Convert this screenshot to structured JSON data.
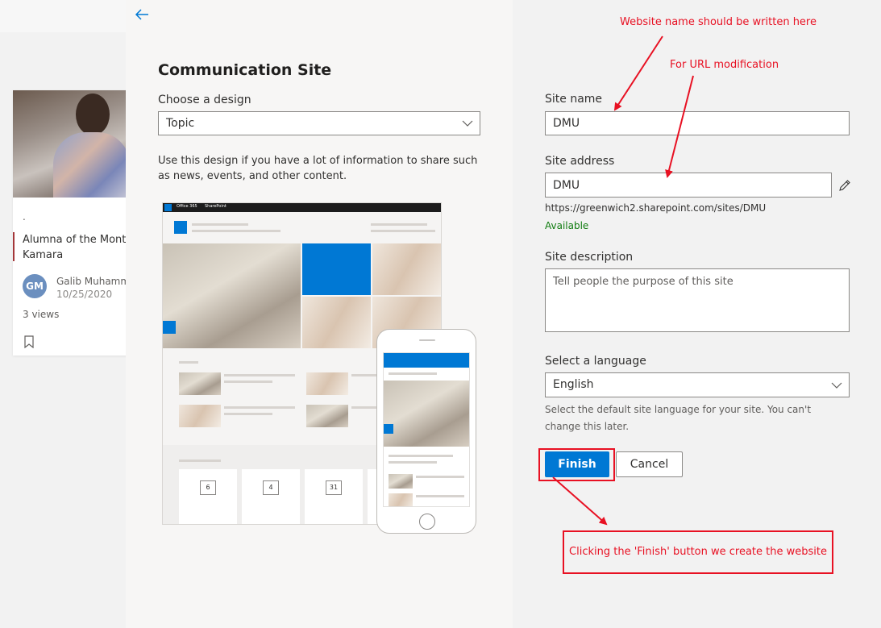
{
  "background": {
    "news_card": {
      "dot": ".",
      "title_line1": "Alumna of the Mont",
      "title_line2": "Kamara",
      "avatar_initials": "GM",
      "author": "Galib Muhamma",
      "date": "10/25/2020",
      "views": "3 views"
    }
  },
  "panel": {
    "title": "Communication Site",
    "design_label": "Choose a design",
    "design_selected": "Topic",
    "design_description": "Use this design if you have a lot of information to share such as news, events, and other content.",
    "preview": {
      "suite_name": "Office 365",
      "app_name": "SharePoint",
      "event_dates": [
        "6",
        "4",
        "31"
      ]
    }
  },
  "form": {
    "site_name_label": "Site name",
    "site_name_value": "DMU",
    "site_address_label": "Site address",
    "site_address_value": "DMU",
    "site_url": "https://greenwich2.sharepoint.com/sites/DMU",
    "availability": "Available",
    "site_description_label": "Site description",
    "site_description_placeholder": "Tell people the purpose of this site",
    "language_label": "Select a language",
    "language_selected": "English",
    "language_help": "Select the default site language for your site. You can't change this later.",
    "finish_label": "Finish",
    "cancel_label": "Cancel"
  },
  "annotations": {
    "site_name_note": "Website name should be written here",
    "url_note": "For URL modification",
    "finish_note": "Clicking the 'Finish' button we create the website"
  },
  "colors": {
    "accent": "#0078d4",
    "annotation": "#e81123",
    "available": "#107c10"
  }
}
